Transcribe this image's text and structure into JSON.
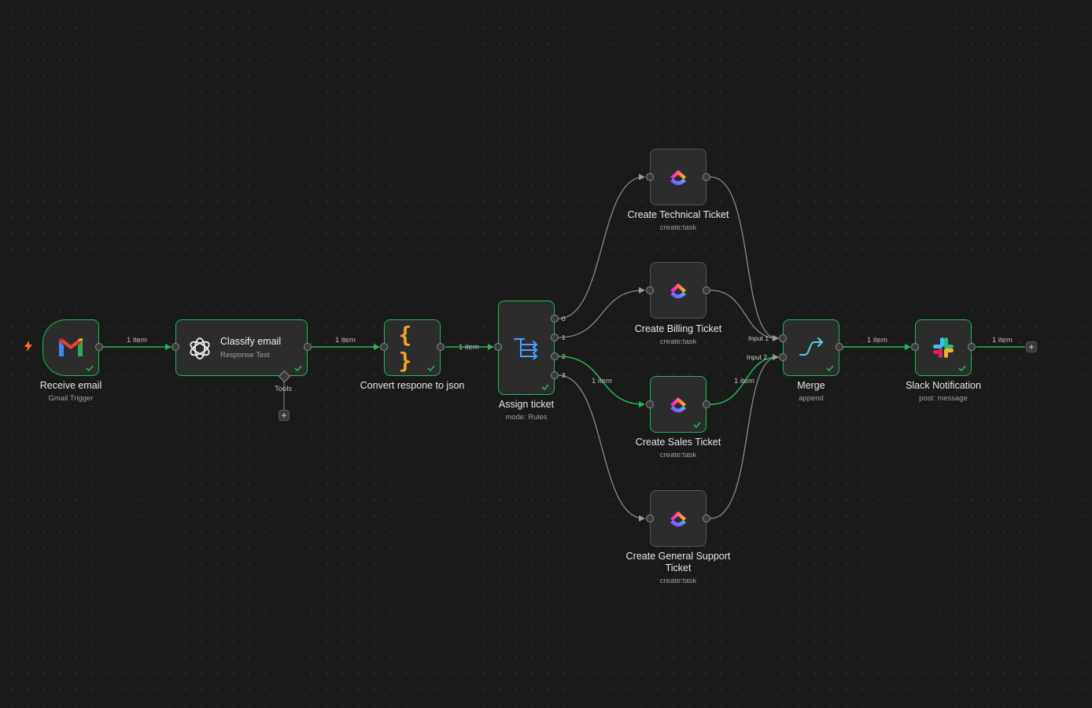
{
  "nodes": {
    "receive_email": {
      "label": "Receive email",
      "sub": "Gmail Trigger"
    },
    "classify_email": {
      "label": "Classify email",
      "sub": "Response Text",
      "tools_label": "Tools"
    },
    "convert_json": {
      "label": "Convert respone to json"
    },
    "assign_ticket": {
      "label": "Assign ticket",
      "sub": "mode: Rules",
      "outputs": [
        "0",
        "1",
        "2",
        "3"
      ]
    },
    "technical": {
      "label": "Create Technical Ticket",
      "sub": "create:task"
    },
    "billing": {
      "label": "Create Billing Ticket",
      "sub": "create:task"
    },
    "sales": {
      "label": "Create Sales Ticket",
      "sub": "create:task"
    },
    "general": {
      "label": "Create General Support Ticket",
      "sub": "create:task"
    },
    "merge": {
      "label": "Merge",
      "sub": "append",
      "input1": "Input 1",
      "input2": "Input 2"
    },
    "slack": {
      "label": "Slack Notification",
      "sub": "post: message"
    }
  },
  "wire_labels": {
    "w1": "1 item",
    "w2": "1 item",
    "w3": "1 item",
    "w_sales_in": "1 item",
    "w_sales_out": "1 item",
    "w_merge": "1 item",
    "w_slack": "1 item"
  },
  "plus_symbol": "+",
  "colors": {
    "success": "#1db954",
    "background": "#1a1a1a",
    "node": "#2c2c2c",
    "trigger": "#ff6d2c"
  }
}
